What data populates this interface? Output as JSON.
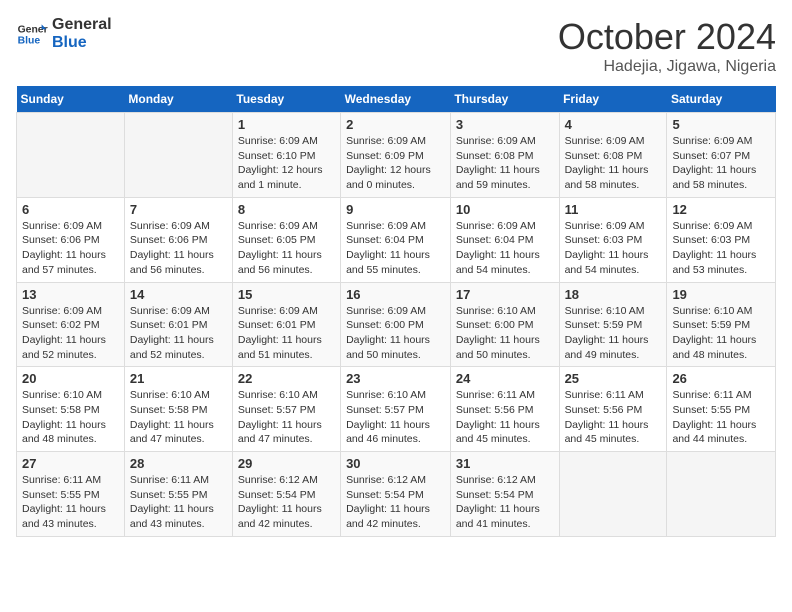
{
  "header": {
    "logo_line1": "General",
    "logo_line2": "Blue",
    "month": "October 2024",
    "location": "Hadejia, Jigawa, Nigeria"
  },
  "weekdays": [
    "Sunday",
    "Monday",
    "Tuesday",
    "Wednesday",
    "Thursday",
    "Friday",
    "Saturday"
  ],
  "weeks": [
    [
      {
        "day": "",
        "info": ""
      },
      {
        "day": "",
        "info": ""
      },
      {
        "day": "1",
        "info": "Sunrise: 6:09 AM\nSunset: 6:10 PM\nDaylight: 12 hours\nand 1 minute."
      },
      {
        "day": "2",
        "info": "Sunrise: 6:09 AM\nSunset: 6:09 PM\nDaylight: 12 hours\nand 0 minutes."
      },
      {
        "day": "3",
        "info": "Sunrise: 6:09 AM\nSunset: 6:08 PM\nDaylight: 11 hours\nand 59 minutes."
      },
      {
        "day": "4",
        "info": "Sunrise: 6:09 AM\nSunset: 6:08 PM\nDaylight: 11 hours\nand 58 minutes."
      },
      {
        "day": "5",
        "info": "Sunrise: 6:09 AM\nSunset: 6:07 PM\nDaylight: 11 hours\nand 58 minutes."
      }
    ],
    [
      {
        "day": "6",
        "info": "Sunrise: 6:09 AM\nSunset: 6:06 PM\nDaylight: 11 hours\nand 57 minutes."
      },
      {
        "day": "7",
        "info": "Sunrise: 6:09 AM\nSunset: 6:06 PM\nDaylight: 11 hours\nand 56 minutes."
      },
      {
        "day": "8",
        "info": "Sunrise: 6:09 AM\nSunset: 6:05 PM\nDaylight: 11 hours\nand 56 minutes."
      },
      {
        "day": "9",
        "info": "Sunrise: 6:09 AM\nSunset: 6:04 PM\nDaylight: 11 hours\nand 55 minutes."
      },
      {
        "day": "10",
        "info": "Sunrise: 6:09 AM\nSunset: 6:04 PM\nDaylight: 11 hours\nand 54 minutes."
      },
      {
        "day": "11",
        "info": "Sunrise: 6:09 AM\nSunset: 6:03 PM\nDaylight: 11 hours\nand 54 minutes."
      },
      {
        "day": "12",
        "info": "Sunrise: 6:09 AM\nSunset: 6:03 PM\nDaylight: 11 hours\nand 53 minutes."
      }
    ],
    [
      {
        "day": "13",
        "info": "Sunrise: 6:09 AM\nSunset: 6:02 PM\nDaylight: 11 hours\nand 52 minutes."
      },
      {
        "day": "14",
        "info": "Sunrise: 6:09 AM\nSunset: 6:01 PM\nDaylight: 11 hours\nand 52 minutes."
      },
      {
        "day": "15",
        "info": "Sunrise: 6:09 AM\nSunset: 6:01 PM\nDaylight: 11 hours\nand 51 minutes."
      },
      {
        "day": "16",
        "info": "Sunrise: 6:09 AM\nSunset: 6:00 PM\nDaylight: 11 hours\nand 50 minutes."
      },
      {
        "day": "17",
        "info": "Sunrise: 6:10 AM\nSunset: 6:00 PM\nDaylight: 11 hours\nand 50 minutes."
      },
      {
        "day": "18",
        "info": "Sunrise: 6:10 AM\nSunset: 5:59 PM\nDaylight: 11 hours\nand 49 minutes."
      },
      {
        "day": "19",
        "info": "Sunrise: 6:10 AM\nSunset: 5:59 PM\nDaylight: 11 hours\nand 48 minutes."
      }
    ],
    [
      {
        "day": "20",
        "info": "Sunrise: 6:10 AM\nSunset: 5:58 PM\nDaylight: 11 hours\nand 48 minutes."
      },
      {
        "day": "21",
        "info": "Sunrise: 6:10 AM\nSunset: 5:58 PM\nDaylight: 11 hours\nand 47 minutes."
      },
      {
        "day": "22",
        "info": "Sunrise: 6:10 AM\nSunset: 5:57 PM\nDaylight: 11 hours\nand 47 minutes."
      },
      {
        "day": "23",
        "info": "Sunrise: 6:10 AM\nSunset: 5:57 PM\nDaylight: 11 hours\nand 46 minutes."
      },
      {
        "day": "24",
        "info": "Sunrise: 6:11 AM\nSunset: 5:56 PM\nDaylight: 11 hours\nand 45 minutes."
      },
      {
        "day": "25",
        "info": "Sunrise: 6:11 AM\nSunset: 5:56 PM\nDaylight: 11 hours\nand 45 minutes."
      },
      {
        "day": "26",
        "info": "Sunrise: 6:11 AM\nSunset: 5:55 PM\nDaylight: 11 hours\nand 44 minutes."
      }
    ],
    [
      {
        "day": "27",
        "info": "Sunrise: 6:11 AM\nSunset: 5:55 PM\nDaylight: 11 hours\nand 43 minutes."
      },
      {
        "day": "28",
        "info": "Sunrise: 6:11 AM\nSunset: 5:55 PM\nDaylight: 11 hours\nand 43 minutes."
      },
      {
        "day": "29",
        "info": "Sunrise: 6:12 AM\nSunset: 5:54 PM\nDaylight: 11 hours\nand 42 minutes."
      },
      {
        "day": "30",
        "info": "Sunrise: 6:12 AM\nSunset: 5:54 PM\nDaylight: 11 hours\nand 42 minutes."
      },
      {
        "day": "31",
        "info": "Sunrise: 6:12 AM\nSunset: 5:54 PM\nDaylight: 11 hours\nand 41 minutes."
      },
      {
        "day": "",
        "info": ""
      },
      {
        "day": "",
        "info": ""
      }
    ]
  ]
}
